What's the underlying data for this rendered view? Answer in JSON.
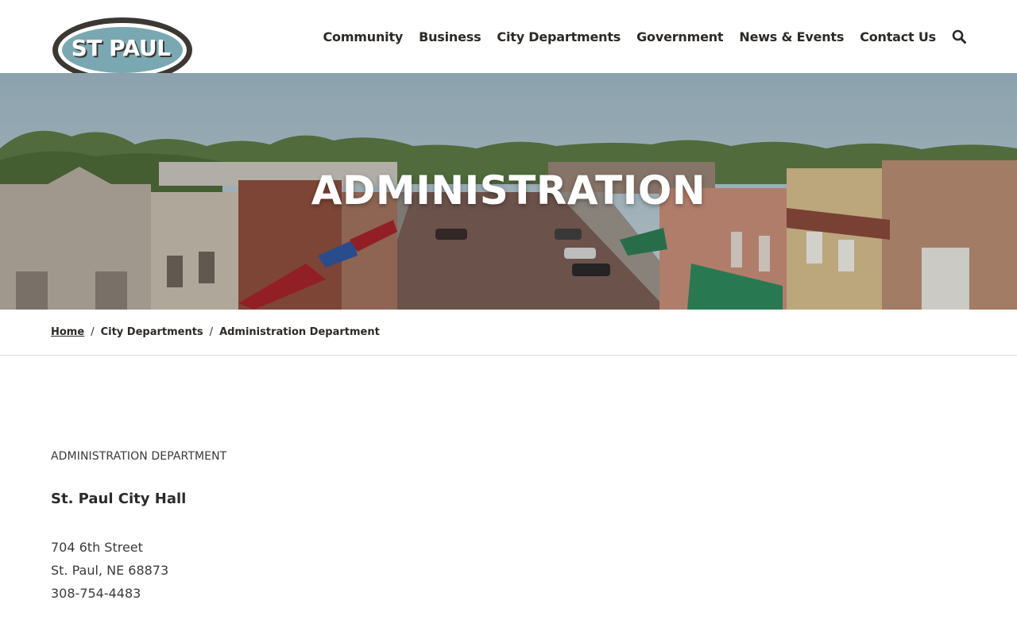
{
  "header": {
    "logo_text": "ST PAUL",
    "nav": [
      {
        "label": "Community"
      },
      {
        "label": "Business"
      },
      {
        "label": "City Departments"
      },
      {
        "label": "Government"
      },
      {
        "label": "News & Events"
      },
      {
        "label": "Contact Us"
      }
    ],
    "search_icon": "search-icon"
  },
  "hero": {
    "title": "ADMINISTRATION"
  },
  "breadcrumb": {
    "home": "Home",
    "separator": "/",
    "section": "City Departments",
    "current": "Administration Department"
  },
  "content": {
    "label": "ADMINISTRATION DEPARTMENT",
    "office": "St. Paul City Hall",
    "street": "704 6th Street",
    "city_state_zip": "St. Paul, NE 68873",
    "phone": "308-754-4483"
  },
  "colors": {
    "logo_fill": "#7aa8b2",
    "logo_border": "#3b3733",
    "text_dark": "#2c2a27"
  }
}
